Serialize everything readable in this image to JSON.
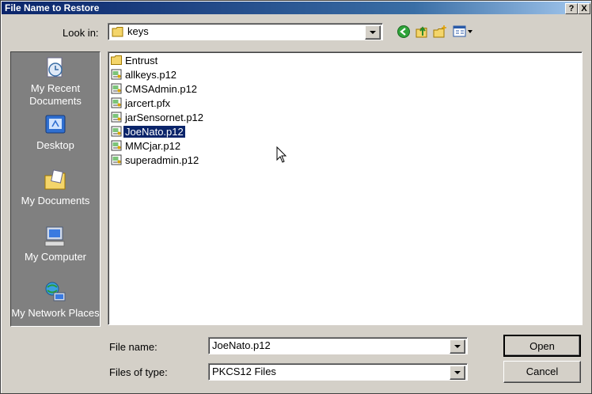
{
  "window": {
    "title": "File Name to Restore",
    "help_glyph": "?",
    "close_glyph": "X"
  },
  "lookin": {
    "label": "Look in:",
    "value": "keys"
  },
  "toolbar": {
    "icons": [
      "back-icon",
      "up-folder-icon",
      "new-folder-icon",
      "view-menu-icon"
    ]
  },
  "places": [
    {
      "label": "My Recent Documents",
      "icon": "recent-documents-icon"
    },
    {
      "label": "Desktop",
      "icon": "desktop-icon"
    },
    {
      "label": "My Documents",
      "icon": "my-documents-icon"
    },
    {
      "label": "My Computer",
      "icon": "my-computer-icon"
    },
    {
      "label": "My Network Places",
      "icon": "network-places-icon"
    }
  ],
  "files": [
    {
      "name": "Entrust",
      "kind": "folder"
    },
    {
      "name": "allkeys.p12",
      "kind": "cert"
    },
    {
      "name": "CMSAdmin.p12",
      "kind": "cert"
    },
    {
      "name": "jarcert.pfx",
      "kind": "cert"
    },
    {
      "name": "jarSensornet.p12",
      "kind": "cert"
    },
    {
      "name": "JoeNato.p12",
      "kind": "cert",
      "selected": true
    },
    {
      "name": "MMCjar.p12",
      "kind": "cert"
    },
    {
      "name": "superadmin.p12",
      "kind": "cert"
    }
  ],
  "filename": {
    "label": "File name:",
    "value": "JoeNato.p12"
  },
  "filetype": {
    "label": "Files of type:",
    "value": "PKCS12 Files"
  },
  "buttons": {
    "open": "Open",
    "cancel": "Cancel"
  },
  "colors": {
    "title_bar": "#0a246a",
    "selection": "#0a246a",
    "face": "#d4d0c8",
    "places_bar": "#808080"
  }
}
